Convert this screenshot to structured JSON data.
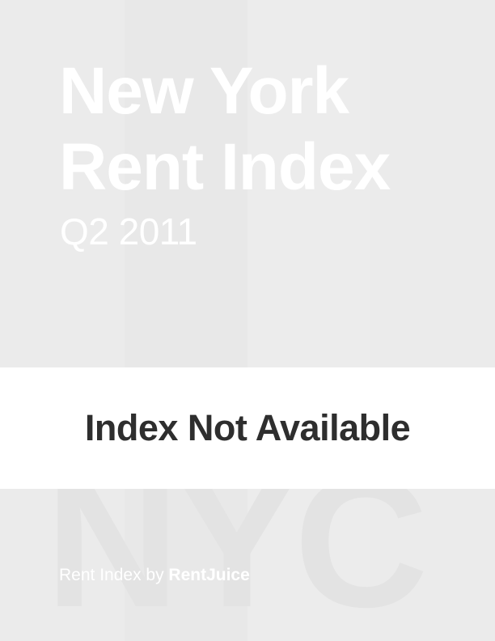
{
  "report": {
    "title_line1": "New York",
    "title_line2": "Rent Index",
    "period": "Q2 2011"
  },
  "notice": {
    "text": "Index Not Available"
  },
  "watermark": {
    "text": "NYC"
  },
  "footer": {
    "prefix": "Rent Index by ",
    "brand": "RentJuice"
  },
  "colors": {
    "background": "#ebebeb",
    "notice_bar": "#ffffff",
    "notice_text": "#2e2e2e",
    "title_text": "#ffffff"
  }
}
